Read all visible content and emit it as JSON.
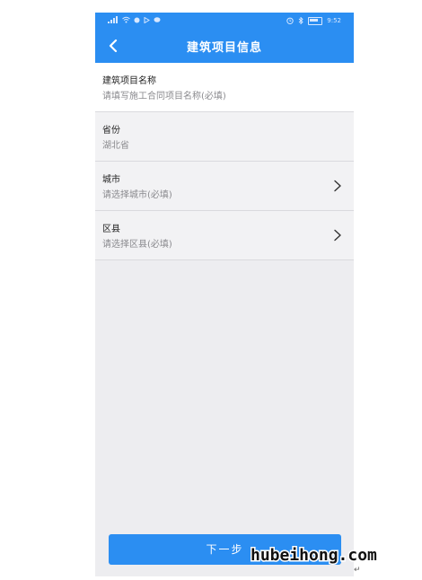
{
  "status_bar": {
    "left_icons": [
      "signal-icon",
      "wifi-icon",
      "circle-icon",
      "play-icon",
      "chat-icon"
    ],
    "right_icons": [
      "alarm-icon",
      "bluetooth-icon",
      "battery-icon"
    ],
    "time": "9:52"
  },
  "navbar": {
    "title": "建筑项目信息",
    "back_icon": "chevron-left-icon"
  },
  "form": {
    "rows": [
      {
        "label": "建筑项目名称",
        "value": "请填写施工合同项目名称(必填)",
        "has_chevron": false
      },
      {
        "label": "省份",
        "value": "湖北省",
        "has_chevron": false
      },
      {
        "label": "城市",
        "value": "请选择城市(必填)",
        "has_chevron": true
      },
      {
        "label": "区县",
        "value": "请选择区县(必填)",
        "has_chevron": true
      }
    ]
  },
  "footer": {
    "next_label": "下一步"
  },
  "watermark": {
    "text": "hubeihong.com"
  },
  "colors": {
    "primary": "#2b8ef2",
    "background": "#ededf0"
  }
}
